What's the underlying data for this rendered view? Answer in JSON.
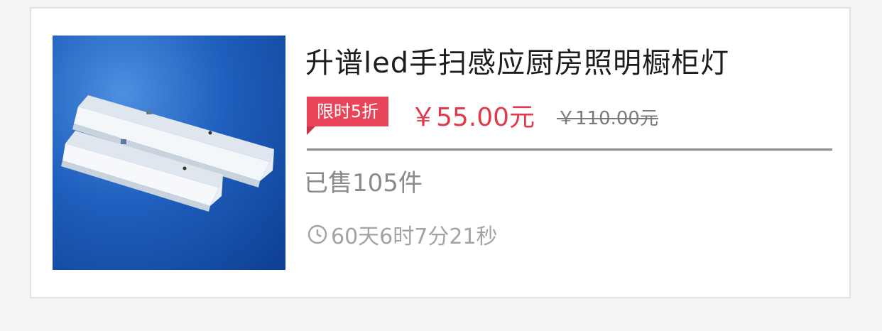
{
  "product": {
    "title": "升谱led手扫感应厨房照明橱柜灯",
    "image_icon": "led-cabinet-light-product-image",
    "badge": "限时5折",
    "price_now": "￥55.00元",
    "price_original": "￥110.00元",
    "sold": "已售105件",
    "countdown": "60天6时7分21秒",
    "countdown_icon": "clock-icon"
  },
  "colors": {
    "badge": "#e8455a",
    "price": "#e03a4b",
    "image_background": "#1f5fbd"
  }
}
